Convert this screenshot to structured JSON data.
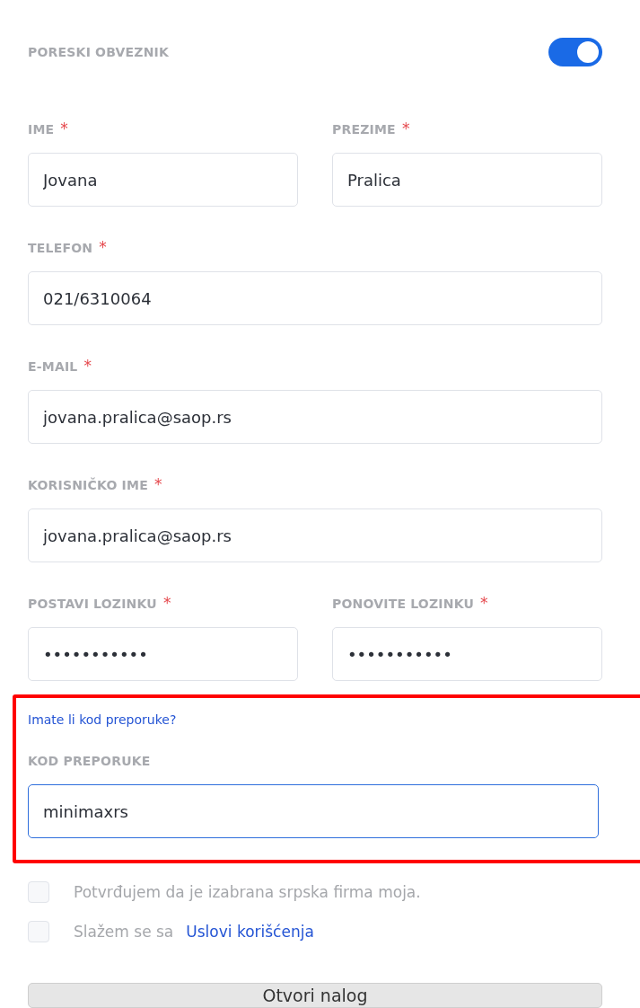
{
  "taxpayer": {
    "label": "PORESKI OBVEZNIK",
    "on": true
  },
  "field_rows": [
    [
      {
        "label": "IME",
        "required_mark": "*",
        "value": "Jovana",
        "focused": false
      },
      {
        "label": "PREZIME",
        "required_mark": "*",
        "value": "Pralica",
        "focused": false
      }
    ],
    [
      {
        "label": "TELEFON",
        "required_mark": "*",
        "value": "021/6310064",
        "focused": false
      }
    ],
    [
      {
        "label": "E-MAIL",
        "required_mark": "*",
        "value": "jovana.pralica@saop.rs",
        "focused": false
      }
    ],
    [
      {
        "label": "KORISNIČKO IME",
        "required_mark": "*",
        "value": "jovana.pralica@saop.rs",
        "focused": false
      }
    ],
    [
      {
        "label": "POSTAVI LOZINKU",
        "required_mark": "*",
        "value": "•••••••••••",
        "focused": false
      },
      {
        "label": "PONOVITE LOZINKU",
        "required_mark": "*",
        "value": "•••••••••••",
        "focused": false
      }
    ]
  ],
  "referral": {
    "highlighted": true,
    "link": "Imate li kod preporuke?",
    "label": "KOD PREPORUKE",
    "value": "minimaxrs",
    "focused": true
  },
  "checkboxes": [
    {
      "text": "Potvrđujem da je izabrana srpska firma moja.",
      "checked": false
    },
    {
      "text": "Slažem se sa",
      "link": "Uslovi korišćenja",
      "checked": false
    }
  ],
  "submit": "Otvori nalog"
}
